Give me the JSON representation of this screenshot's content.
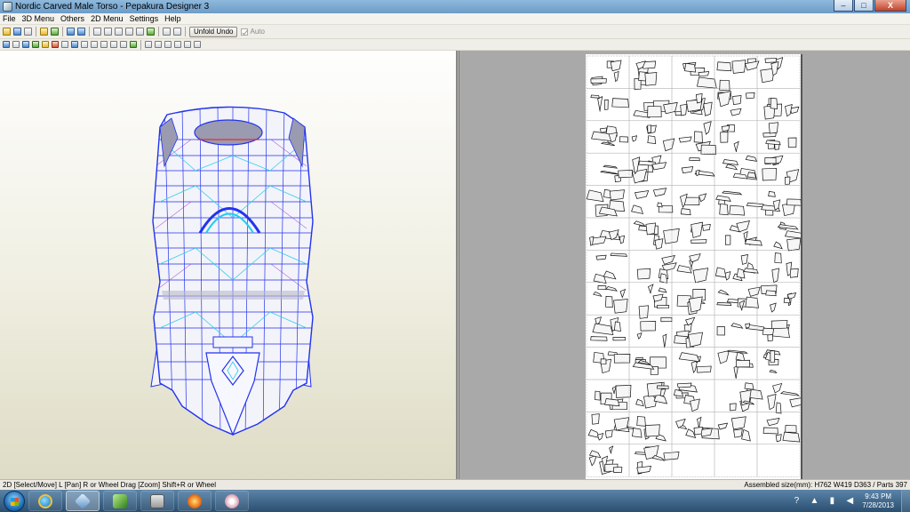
{
  "window": {
    "title": "Nordic Carved Male Torso - Pepakura Designer 3",
    "controls": {
      "minimize": "–",
      "maximize": "□",
      "close": "X"
    }
  },
  "menu": [
    "File",
    "3D Menu",
    "Others",
    "2D Menu",
    "Settings",
    "Help"
  ],
  "toolbar": {
    "unfold_undo_label": "Unfold Undo",
    "auto_label": "Auto",
    "icons_row1": [
      "open-icon",
      "save-icon",
      "print-icon",
      "view-3d-icon",
      "texture-icon",
      "undo-icon",
      "redo-icon",
      "edit-icon",
      "ruler-icon",
      "anchor-icon",
      "select-icon",
      "join-icon",
      "split-icon",
      "settings-icon",
      "window-icon",
      "window2-icon"
    ],
    "icons_row2": [
      "select-move-icon",
      "rotate-icon",
      "flip-icon",
      "move-icon",
      "scale-icon",
      "join-edge-icon",
      "separate-icon",
      "fold-icon",
      "flap-icon",
      "text-icon",
      "image-icon",
      "grid-icon",
      "line-icon",
      "check-icon",
      "align-left-icon",
      "align-center-icon",
      "align-right-icon",
      "undo-2d-icon",
      "redo-2d-icon",
      "zoom-icon"
    ]
  },
  "status": {
    "left": "2D [Select/Move] L [Pan] R or Wheel Drag [Zoom] Shift+R or Wheel",
    "right": "Assembled size(mm): H762 W419 D363 / Parts 397"
  },
  "taskbar": {
    "apps": [
      "internet-explorer-icon",
      "pepakura-icon",
      "leaf-app-icon",
      "media-center-icon",
      "firefox-icon",
      "web-app-icon"
    ],
    "time": "9:43 PM",
    "date": "7/28/2013"
  },
  "colors": {
    "model_stroke": "#2233ee",
    "model_stroke_light": "#22ccee",
    "model_fill": "#f3f3fa",
    "model_shadow": "#9a9ab0"
  }
}
